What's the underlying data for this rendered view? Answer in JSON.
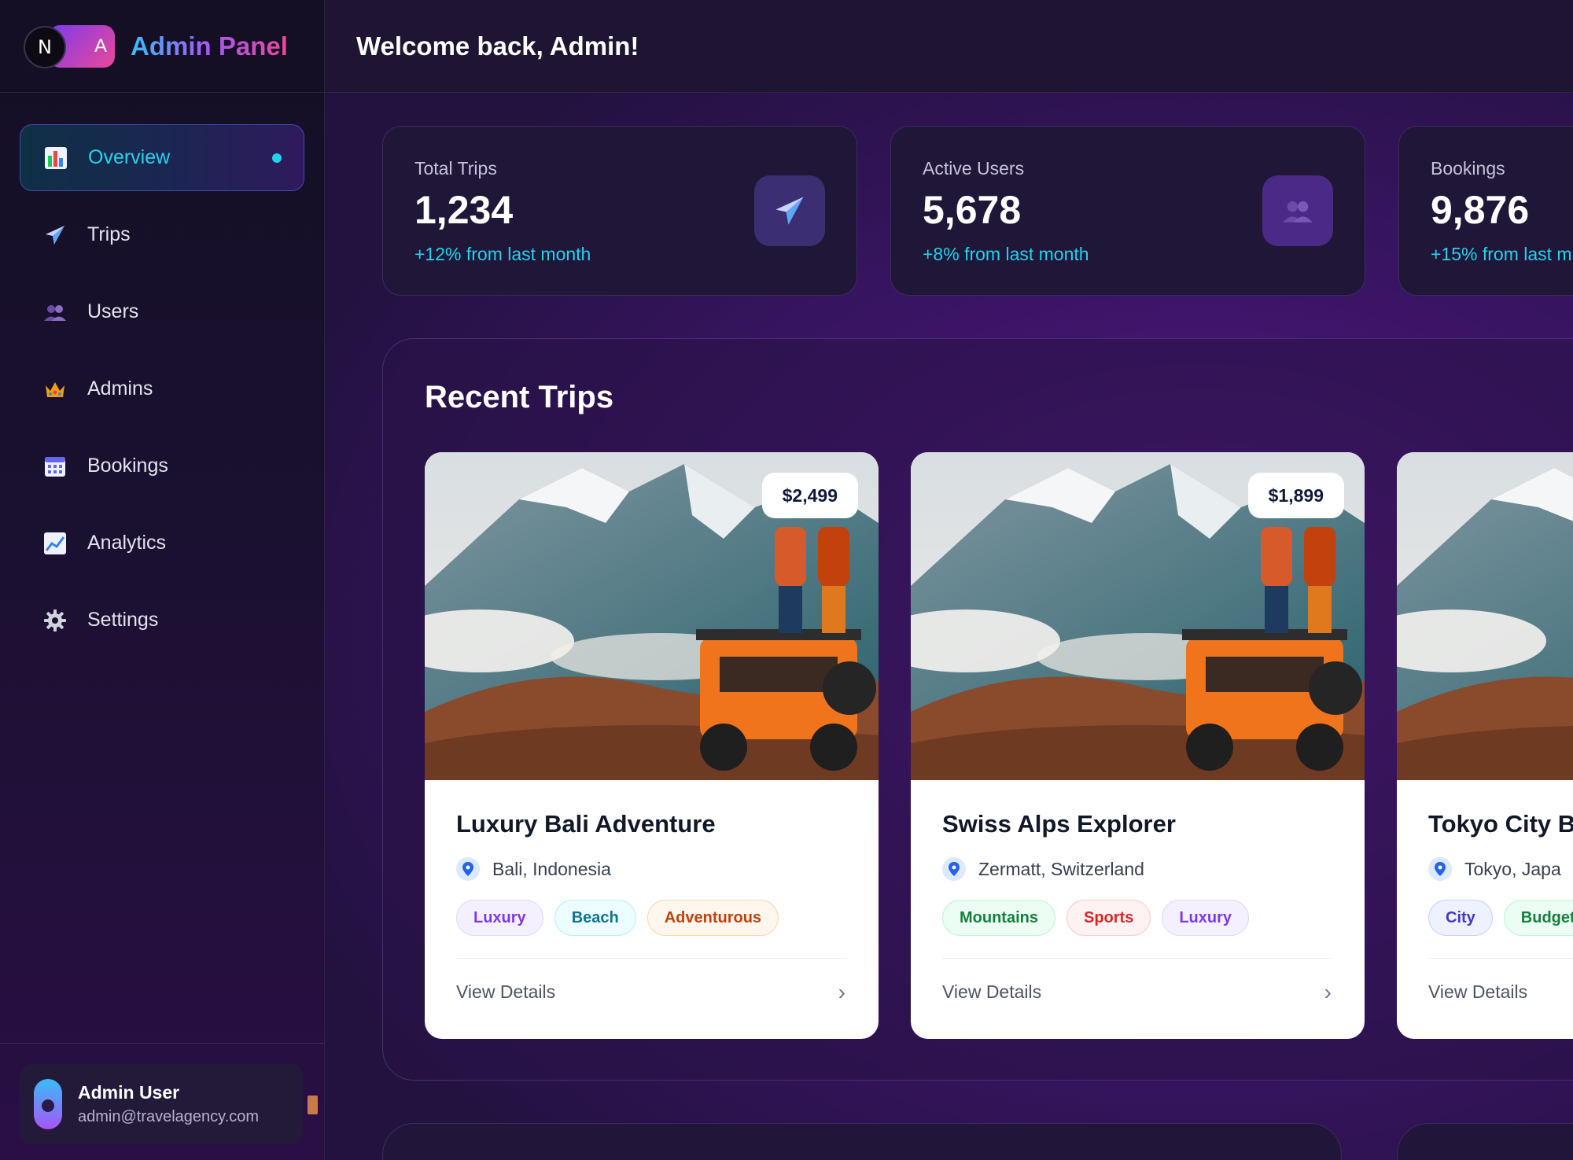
{
  "brand": {
    "logo_letter": "N",
    "logo_letter2": "A",
    "title": "Admin Panel"
  },
  "sidebar": {
    "items": [
      {
        "label": "Overview",
        "icon": "bar-chart-icon",
        "active": true
      },
      {
        "label": "Trips",
        "icon": "airplane-icon"
      },
      {
        "label": "Users",
        "icon": "users-icon"
      },
      {
        "label": "Admins",
        "icon": "crown-icon"
      },
      {
        "label": "Bookings",
        "icon": "calendar-icon"
      },
      {
        "label": "Analytics",
        "icon": "chart-line-icon"
      },
      {
        "label": "Settings",
        "icon": "gear-icon"
      }
    ],
    "user": {
      "name": "Admin User",
      "email": "admin@travelagency.com"
    }
  },
  "header": {
    "welcome": "Welcome back, Admin!"
  },
  "stats": [
    {
      "label": "Total Trips",
      "value": "1,234",
      "change": "+12% from last month",
      "icon": "airplane-icon"
    },
    {
      "label": "Active Users",
      "value": "5,678",
      "change": "+8% from last month",
      "icon": "users-icon"
    },
    {
      "label": "Bookings",
      "value": "9,876",
      "change": "+15% from last m"
    }
  ],
  "recent_trips": {
    "title": "Recent Trips",
    "view_details_label": "View Details",
    "trips": [
      {
        "name": "Luxury Bali Adventure",
        "location": "Bali, Indonesia",
        "price": "$2,499",
        "tags": [
          "Luxury",
          "Beach",
          "Adventurous"
        ]
      },
      {
        "name": "Swiss Alps Explorer",
        "location": "Zermatt, Switzerland",
        "price": "$1,899",
        "tags": [
          "Mountains",
          "Sports",
          "Luxury"
        ]
      },
      {
        "name": "Tokyo City B",
        "location": "Tokyo, Japa",
        "tags": [
          "City",
          "Budget"
        ]
      }
    ]
  },
  "colors": {
    "accent_cyan": "#22d3ee",
    "brand_purple": "#7c3aed",
    "brand_pink": "#ec4899"
  }
}
